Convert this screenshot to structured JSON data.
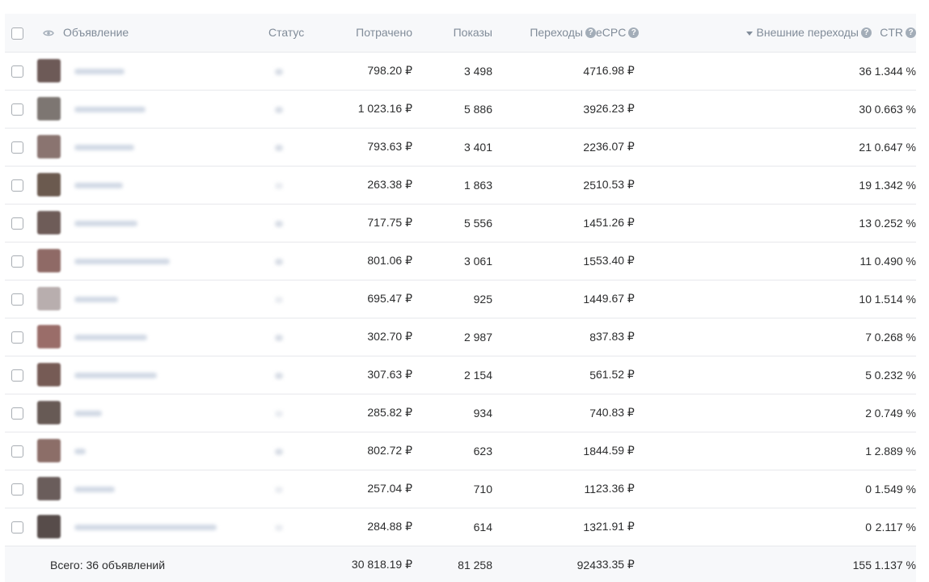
{
  "table": {
    "columns": {
      "name": "Объявление",
      "status": "Статус",
      "spent": "Потрачено",
      "shows": "Показы",
      "clicks": "Переходы",
      "ecpc": "eCPC",
      "external": "Внешние переходы",
      "ctr": "CTR"
    },
    "help_glyph": "?",
    "rows": [
      {
        "spent": "798.20 ₽",
        "shows": "3 498",
        "clicks": "47",
        "ecpc": "16.98 ₽",
        "external": "36",
        "ctr": "1.344 %",
        "thumb_color": "#6d5a57"
      },
      {
        "spent": "1 023.16 ₽",
        "shows": "5 886",
        "clicks": "39",
        "ecpc": "26.23 ₽",
        "external": "30",
        "ctr": "0.663 %",
        "thumb_color": "#7d7672"
      },
      {
        "spent": "793.63 ₽",
        "shows": "3 401",
        "clicks": "22",
        "ecpc": "36.07 ₽",
        "external": "21",
        "ctr": "0.647 %",
        "thumb_color": "#8a7470"
      },
      {
        "spent": "263.38 ₽",
        "shows": "1 863",
        "clicks": "25",
        "ecpc": "10.53 ₽",
        "external": "19",
        "ctr": "1.342 %",
        "thumb_color": "#6b5a4f"
      },
      {
        "spent": "717.75 ₽",
        "shows": "5 556",
        "clicks": "14",
        "ecpc": "51.26 ₽",
        "external": "13",
        "ctr": "0.252 %",
        "thumb_color": "#6e5c58"
      },
      {
        "spent": "801.06 ₽",
        "shows": "3 061",
        "clicks": "15",
        "ecpc": "53.40 ₽",
        "external": "11",
        "ctr": "0.490 %",
        "thumb_color": "#8f6a66"
      },
      {
        "spent": "695.47 ₽",
        "shows": "925",
        "clicks": "14",
        "ecpc": "49.67 ₽",
        "external": "10",
        "ctr": "1.514 %",
        "thumb_color": "#b8aeae"
      },
      {
        "spent": "302.70 ₽",
        "shows": "2 987",
        "clicks": "8",
        "ecpc": "37.83 ₽",
        "external": "7",
        "ctr": "0.268 %",
        "thumb_color": "#9a6d69"
      },
      {
        "spent": "307.63 ₽",
        "shows": "2 154",
        "clicks": "5",
        "ecpc": "61.52 ₽",
        "external": "5",
        "ctr": "0.232 %",
        "thumb_color": "#765b55"
      },
      {
        "spent": "285.82 ₽",
        "shows": "934",
        "clicks": "7",
        "ecpc": "40.83 ₽",
        "external": "2",
        "ctr": "0.749 %",
        "thumb_color": "#675a55"
      },
      {
        "spent": "802.72 ₽",
        "shows": "623",
        "clicks": "18",
        "ecpc": "44.59 ₽",
        "external": "1",
        "ctr": "2.889 %",
        "thumb_color": "#8c6e68"
      },
      {
        "spent": "257.04 ₽",
        "shows": "710",
        "clicks": "11",
        "ecpc": "23.36 ₽",
        "external": "0",
        "ctr": "1.549 %",
        "thumb_color": "#6a5d5b"
      },
      {
        "spent": "284.88 ₽",
        "shows": "614",
        "clicks": "13",
        "ecpc": "21.91 ₽",
        "external": "0",
        "ctr": "2.117 %",
        "thumb_color": "#574c4a"
      }
    ],
    "total": {
      "label": "Всего: 36 объявлений",
      "spent": "30 818.19 ₽",
      "shows": "81 258",
      "clicks": "924",
      "ecpc": "33.35 ₽",
      "external": "155",
      "ctr": "1.137 %"
    }
  },
  "colors": {
    "header_bg": "#f7f8fa",
    "header_text": "#818c99",
    "row_border": "#e7e8ec",
    "text": "#2c2d2e"
  },
  "icons": {
    "visibility": "eye-icon",
    "help": "question-circle-icon",
    "sort": "sort-desc-icon",
    "select": "checkbox-icon"
  }
}
